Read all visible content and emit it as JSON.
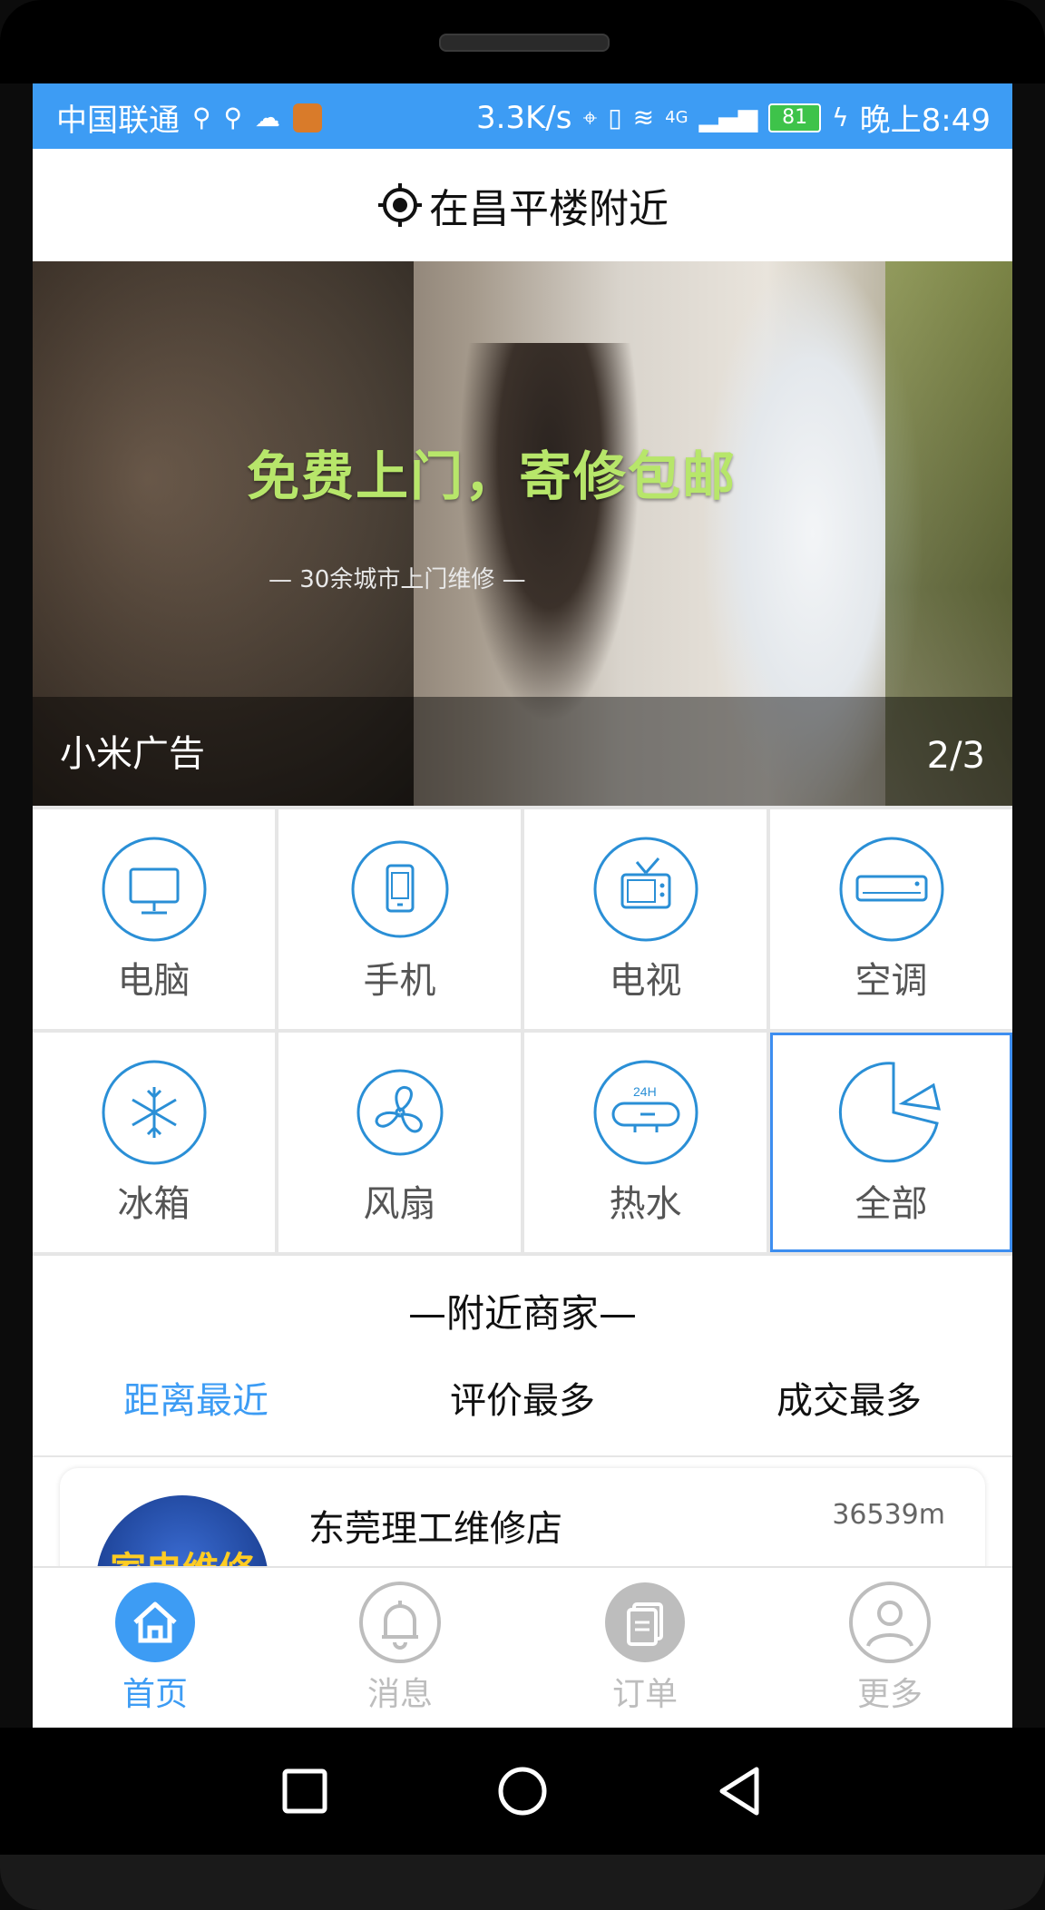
{
  "status_bar": {
    "carrier": "中国联通",
    "speed": "3.3K/s",
    "network": "4G",
    "battery": "81",
    "time": "晚上8:49"
  },
  "header": {
    "location_title": "在昌平楼附近",
    "location_icon": "locate-icon"
  },
  "banner": {
    "slogan": "免费上门，寄修包邮",
    "subslogan": "— 30余城市上门维修 —",
    "caption": "小米广告",
    "counter": "2/3"
  },
  "categories": [
    {
      "label": "电脑",
      "icon": "computer-icon"
    },
    {
      "label": "手机",
      "icon": "phone-icon"
    },
    {
      "label": "电视",
      "icon": "tv-icon"
    },
    {
      "label": "空调",
      "icon": "air-conditioner-icon"
    },
    {
      "label": "冰箱",
      "icon": "fridge-icon"
    },
    {
      "label": "风扇",
      "icon": "fan-icon"
    },
    {
      "label": "热水",
      "icon": "water-heater-icon"
    },
    {
      "label": "全部",
      "icon": "all-icon"
    }
  ],
  "nearby": {
    "section_title": "—附近商家—",
    "tabs": [
      "距离最近",
      "评价最多",
      "成交最多"
    ],
    "active_tab": 0,
    "shops": [
      {
        "name": "东莞理工维修店",
        "distance": "36539m",
        "logo_text": "家电维修"
      }
    ]
  },
  "bottom_nav": [
    {
      "label": "首页",
      "icon": "home-icon"
    },
    {
      "label": "消息",
      "icon": "bell-icon"
    },
    {
      "label": "订单",
      "icon": "orders-icon"
    },
    {
      "label": "更多",
      "icon": "user-icon"
    }
  ],
  "colors": {
    "accent": "#3d9cf4",
    "icon_blue": "#2a8fd6"
  }
}
